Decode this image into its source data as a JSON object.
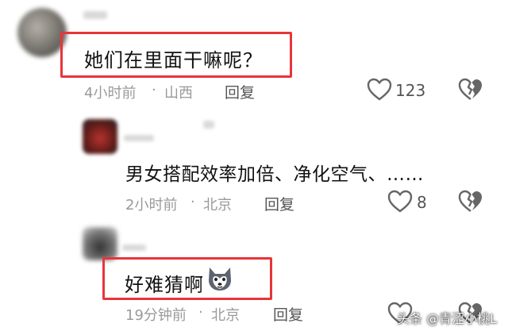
{
  "comments": [
    {
      "text": "她们在里面干嘛呢？",
      "time": "4小时前",
      "location": "山西",
      "reply_label": "回复",
      "likes": "123"
    },
    {
      "text": "男女搭配效率加倍、净化空气、……",
      "time": "2小时前",
      "location": "北京",
      "reply_label": "回复",
      "likes": "8"
    },
    {
      "text": "好难猜啊",
      "time": "19分钟前",
      "location": "北京",
      "reply_label": "回复",
      "likes": ""
    }
  ],
  "separator": "·",
  "watermark": "头条 @青涩小桃L",
  "colors": {
    "highlight": "#e8353a",
    "meta": "#9a9a9a",
    "icon": "#666666"
  },
  "icons": [
    "heart-icon",
    "broken-heart-icon",
    "husky-emoji-icon"
  ]
}
